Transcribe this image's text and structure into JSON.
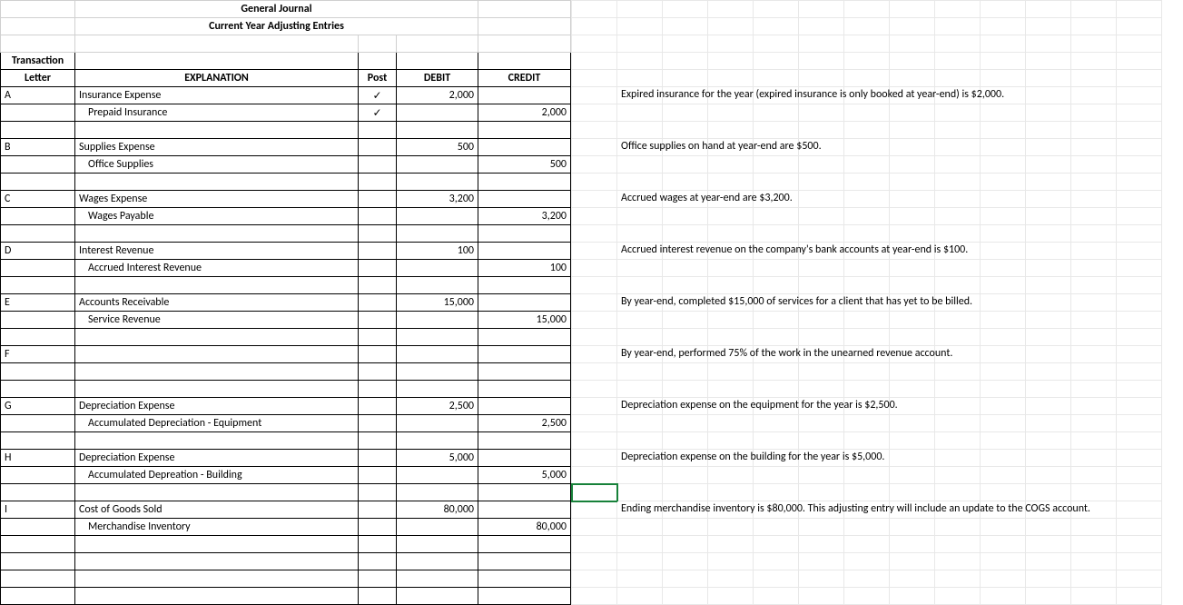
{
  "title1": "General Journal",
  "title2": "Current Year Adjusting Entries",
  "headers": {
    "letter1": "Transaction",
    "letter2": "Letter",
    "explanation": "EXPLANATION",
    "post": "Post",
    "debit": "DEBIT",
    "credit": "CREDIT"
  },
  "check": "✓",
  "entries": {
    "A": {
      "letter": "A",
      "debitLine": "Insurance Expense",
      "creditLine": "Prepaid Insurance",
      "debitAmt": "2,000",
      "creditAmt": "2,000",
      "postDebit": "✓",
      "postCredit": "✓",
      "desc": "Expired insurance for the year (expired insurance is only booked at year-end) is $2,000."
    },
    "B": {
      "letter": "B",
      "debitLine": "Supplies Expense",
      "creditLine": "Office Supplies",
      "debitAmt": "500",
      "creditAmt": "500",
      "desc": "Office supplies on hand at year-end are $500."
    },
    "C": {
      "letter": "C",
      "debitLine": "Wages Expense",
      "creditLine": "Wages Payable",
      "debitAmt": "3,200",
      "creditAmt": "3,200",
      "desc": "Accrued wages at year-end are $3,200."
    },
    "D": {
      "letter": "D",
      "debitLine": "Interest Revenue",
      "creditLine": "Accrued Interest Revenue",
      "debitAmt": "100",
      "creditAmt": "100",
      "desc": "Accrued interest revenue on the company's bank accounts at year-end is $100."
    },
    "E": {
      "letter": "E",
      "debitLine": "Accounts Receivable",
      "creditLine": "Service Revenue",
      "debitAmt": "15,000",
      "creditAmt": "15,000",
      "desc": "By year-end, completed $15,000 of services for a client that has yet to be billed."
    },
    "F": {
      "letter": "F",
      "desc": "By year-end, performed 75% of the work in the unearned revenue account."
    },
    "G": {
      "letter": "G",
      "debitLine": "Depreciation Expense",
      "creditLine": "Accumulated Depreciation - Equipment",
      "debitAmt": "2,500",
      "creditAmt": "2,500",
      "desc": "Depreciation expense on the equipment for the year is $2,500."
    },
    "H": {
      "letter": "H",
      "debitLine": "Depreciation Expense",
      "creditLine": "Accumulated Depreation - Building",
      "debitAmt": "5,000",
      "creditAmt": "5,000",
      "desc": "Depreciation expense on the building for the year is $5,000."
    },
    "I": {
      "letter": "I",
      "debitLine": "Cost of Goods Sold",
      "creditLine": "Merchandise Inventory",
      "debitAmt": "80,000",
      "creditAmt": "80,000",
      "desc": "Ending merchandise inventory is $80,000.  This adjusting entry will include an update to the COGS account."
    }
  }
}
